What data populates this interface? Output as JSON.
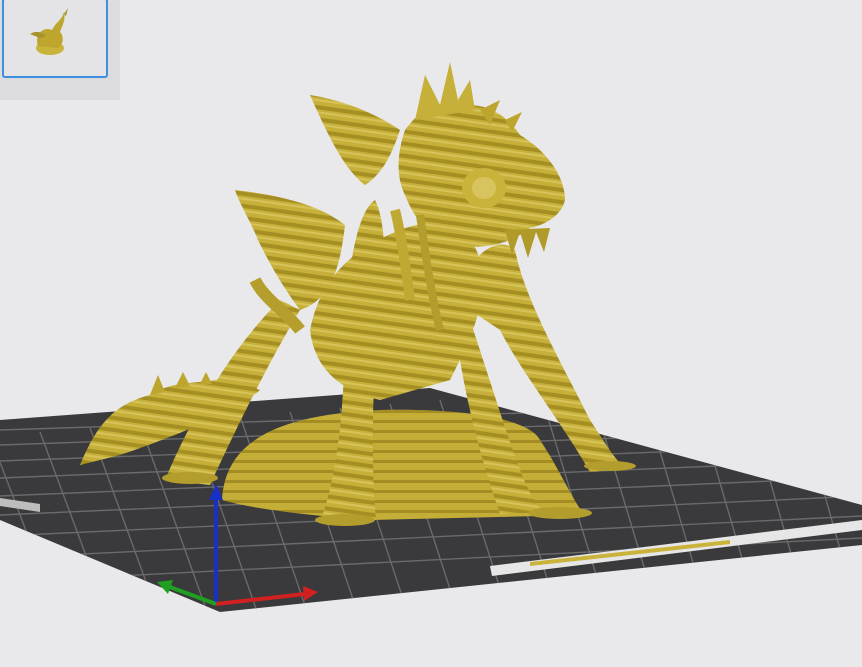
{
  "app": {
    "view": "3d-prepare-view"
  },
  "plate_list": {
    "items": [
      {
        "name": "",
        "selected": true
      }
    ]
  },
  "scene": {
    "object": "dragon-model",
    "filament_color": "#c9b33a",
    "bed_color": "#3a3a3c",
    "grid_color": "#6a6a6c",
    "axes": {
      "x_color": "#d02020",
      "y_color": "#20a020",
      "z_color": "#1a2fc4"
    }
  }
}
